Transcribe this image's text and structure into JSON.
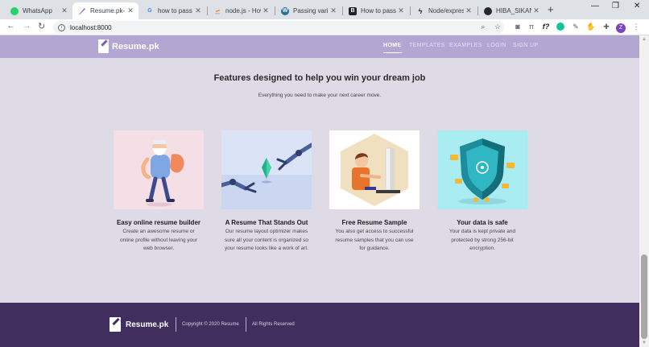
{
  "browser": {
    "tabs": [
      {
        "title": "WhatsApp",
        "icon": "whatsapp-icon",
        "color": "#25d366",
        "glyph": "",
        "active": false
      },
      {
        "title": "Resume.pk- H",
        "icon": "resume-feather-icon",
        "color": "#7b5fc0",
        "glyph": "",
        "active": true
      },
      {
        "title": "how to pass v",
        "icon": "google-icon",
        "color": "#4285f4",
        "glyph": "G",
        "active": false
      },
      {
        "title": "node.js - How",
        "icon": "stackoverflow-icon",
        "color": "#f48024",
        "glyph": "",
        "active": false
      },
      {
        "title": "Passing variab",
        "icon": "wordpress-icon",
        "color": "#21759b",
        "glyph": "W",
        "active": false
      },
      {
        "title": "How to pass v",
        "icon": "bold-b-icon",
        "color": "#202124",
        "glyph": "B",
        "active": false
      },
      {
        "title": "Node/express",
        "icon": "lightning-icon",
        "color": "#202124",
        "glyph": "ϟ",
        "active": false
      },
      {
        "title": "HIBA_SIKAND",
        "icon": "github-icon",
        "color": "#24292e",
        "glyph": "",
        "active": false
      }
    ],
    "url": "localhost:8000"
  },
  "site": {
    "brand": "Resume.pk",
    "nav": {
      "home": "HOME",
      "templates": "TEMPLATES",
      "examples": "EXAMPLES",
      "login": "LOGIN",
      "signup": "SIGN UP"
    },
    "heading": "Features designed to help you win your dream job",
    "subheading": "Everything you need to make your next career move.",
    "features": [
      {
        "title": "Easy online resume builder",
        "lines": [
          "Create an awesome resume or",
          "online profile without leaving your",
          "web browser."
        ]
      },
      {
        "title": "A Resume That Stands Out",
        "lines": [
          "Our resume layout optimizer makes",
          "sure all your content is organized so",
          "your resume looks like a work of art."
        ]
      },
      {
        "title": "Free Resume Sample",
        "lines": [
          "You also get access to successful",
          "resume samples that you can use",
          "for guidance."
        ]
      },
      {
        "title": "Your data is safe",
        "lines": [
          "Your data is kept private and",
          "protected by strong 256-bit",
          "encryption."
        ]
      }
    ],
    "footer": {
      "brand": "Resume.pk",
      "copyright": "Copyright © 2020 Resume",
      "rights": "All Rights Reserved"
    }
  },
  "colors": {
    "nav_bg": "#b3a6d3",
    "page_bg": "#dedbe7",
    "footer_bg": "#3f2e5e",
    "card1_bg": "#f5dfe6",
    "card2_bg": "#dbe3f6",
    "card3_bg": "#ffffff",
    "card4_bg": "#a9ecf2"
  }
}
